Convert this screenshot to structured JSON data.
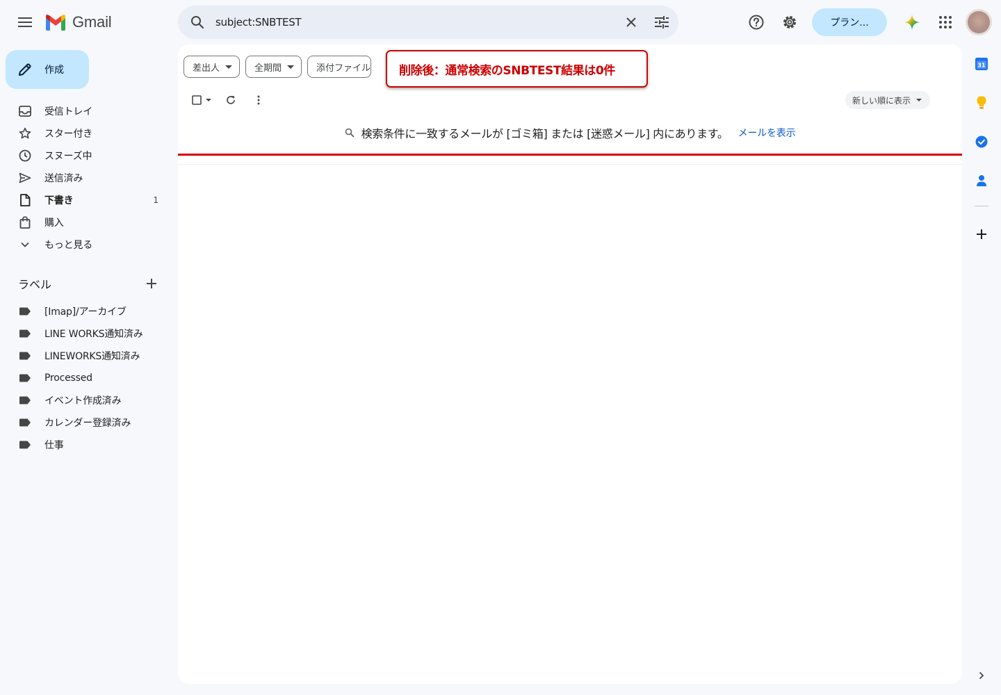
{
  "app": {
    "name": "Gmail"
  },
  "colors": {
    "compose_bg": "#c2e7ff",
    "plan_bg": "#c2e7ff",
    "annotation": "#cc0000",
    "link": "#0b57d0",
    "page_bg": "#f6f8fc"
  },
  "search": {
    "query": "subject:SNBTEST"
  },
  "header": {
    "plan_label": "プラン..."
  },
  "compose": {
    "label": "作成"
  },
  "nav": {
    "items": [
      {
        "label": "受信トレイ",
        "icon": "inbox-icon"
      },
      {
        "label": "スター付き",
        "icon": "star-icon"
      },
      {
        "label": "スヌーズ中",
        "icon": "clock-icon"
      },
      {
        "label": "送信済み",
        "icon": "send-icon"
      },
      {
        "label": "下書き",
        "icon": "draft-icon",
        "count": "1",
        "bold": true
      },
      {
        "label": "購入",
        "icon": "shopping-bag-icon"
      },
      {
        "label": "もっと見る",
        "icon": "chevron-down-icon"
      }
    ]
  },
  "labels": {
    "title": "ラベル",
    "items": [
      "[Imap]/アーカイブ",
      "LINE WORKS通知済み",
      "LINEWORKS通知済み",
      "Processed",
      "イベント作成済み",
      "カレンダー登録済み",
      "仕事"
    ]
  },
  "filters": {
    "sender": "差出人",
    "period": "全期間",
    "attachment": "添付ファイル"
  },
  "annotation": {
    "text": "削除後：通常検索のSNBTEST結果は0件"
  },
  "toolbar": {
    "sort_label": "新しい順に表示"
  },
  "notice": {
    "text": "検索条件に一致するメールが [ゴミ箱] または [迷惑メール] 内にあります。",
    "link": "メールを表示"
  },
  "side_panel": {
    "calendar_day": "31",
    "icons": [
      "calendar-icon",
      "keep-icon",
      "tasks-icon",
      "contacts-icon",
      "add-icon"
    ]
  }
}
